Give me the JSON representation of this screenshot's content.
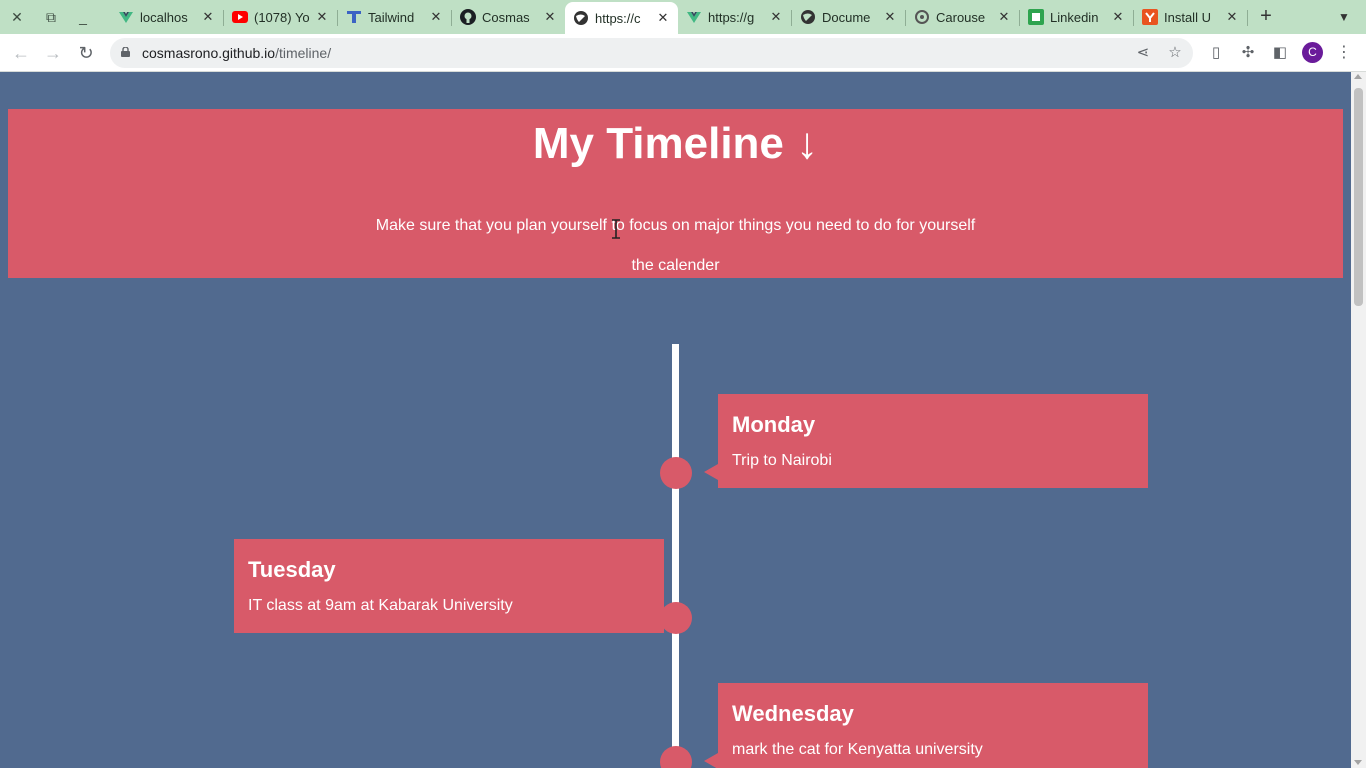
{
  "browser": {
    "tabs": [
      {
        "label": "localhos",
        "icon": "vite-icon",
        "active": false
      },
      {
        "label": "(1078) Yo",
        "icon": "youtube-icon",
        "active": false
      },
      {
        "label": "Tailwind",
        "icon": "tailwind-icon",
        "active": false
      },
      {
        "label": "Cosmas",
        "icon": "github-icon",
        "active": false
      },
      {
        "label": "https://c",
        "icon": "globe-icon",
        "active": true
      },
      {
        "label": "https://g",
        "icon": "vite-icon",
        "active": false
      },
      {
        "label": "Docume",
        "icon": "globe-icon",
        "active": false
      },
      {
        "label": "Carouse",
        "icon": "openai-icon",
        "active": false
      },
      {
        "label": "Linkedin",
        "icon": "linkedin-icon",
        "active": false
      },
      {
        "label": "Install U",
        "icon": "ubuntu-icon",
        "active": false
      }
    ],
    "url_host": "cosmasrono.github.io",
    "url_path": "/timeline/",
    "profile_initial": "C"
  },
  "page": {
    "title": "My Timeline ↓",
    "subtitle": "Make sure that you plan yourself to focus on major things you need to do for yourself",
    "subtitle2": "the calender",
    "events": [
      {
        "day": "Monday",
        "text": "Trip to Nairobi",
        "side": "right"
      },
      {
        "day": "Tuesday",
        "text": "IT class at 9am at Kabarak University",
        "side": "left"
      },
      {
        "day": "Wednesday",
        "text": "mark the cat for Kenyatta university",
        "side": "right"
      }
    ]
  },
  "colors": {
    "page_background": "#516a8f",
    "accent": "#d85a69",
    "tab_strip": "#bfe0c5"
  }
}
